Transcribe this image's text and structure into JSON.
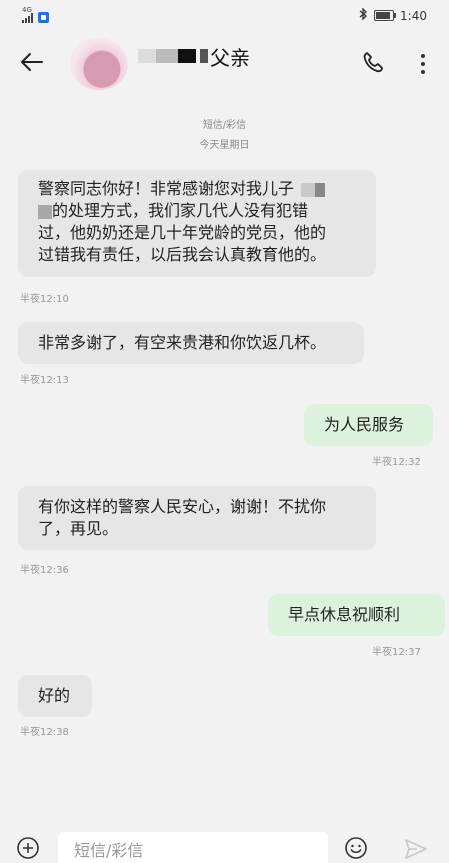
{
  "status_bar": {
    "network": "4G",
    "time": "1:40",
    "battery_level": 0.85,
    "bluetooth_icon": "bluetooth-icon"
  },
  "header": {
    "contact_name": "父亲",
    "back_icon": "back-arrow-icon",
    "call_icon": "phone-icon",
    "more_icon": "more-vertical-icon"
  },
  "conversation": {
    "channel": "短信/彩信",
    "day": "今天星期日"
  },
  "messages": [
    {
      "direction": "incoming",
      "line1": "警察同志你好！非常感谢您对我儿子",
      "line2": "的处理方式，我们家几代人没有犯错",
      "line3": "过，他奶奶还是几十年党龄的党员，他的",
      "line4": "过错我有责任，以后我会认真教育他的。",
      "time": "半夜12:10"
    },
    {
      "direction": "incoming",
      "text": "非常多谢了，有空来贵港和你饮返几杯。",
      "time": "半夜12:13"
    },
    {
      "direction": "outgoing",
      "text": "为人民服务",
      "time": "半夜12:32"
    },
    {
      "direction": "incoming",
      "line1": "有你这样的警察人民安心，谢谢！不扰你",
      "line2": "了，再见。",
      "time": "半夜12:36"
    },
    {
      "direction": "outgoing",
      "text": "早点休息祝顺利",
      "time": "半夜12:37"
    },
    {
      "direction": "incoming",
      "text": "好的",
      "time": "半夜12:38"
    }
  ],
  "input_bar": {
    "placeholder": "短信/彩信",
    "add_icon": "add-circle-icon",
    "emoji_icon": "emoji-icon",
    "send_icon": "send-icon"
  },
  "colors": {
    "incoming_bubble": "#e6e6e6",
    "outgoing_bubble": "#dcf2dc",
    "background": "#f2f2f2"
  }
}
